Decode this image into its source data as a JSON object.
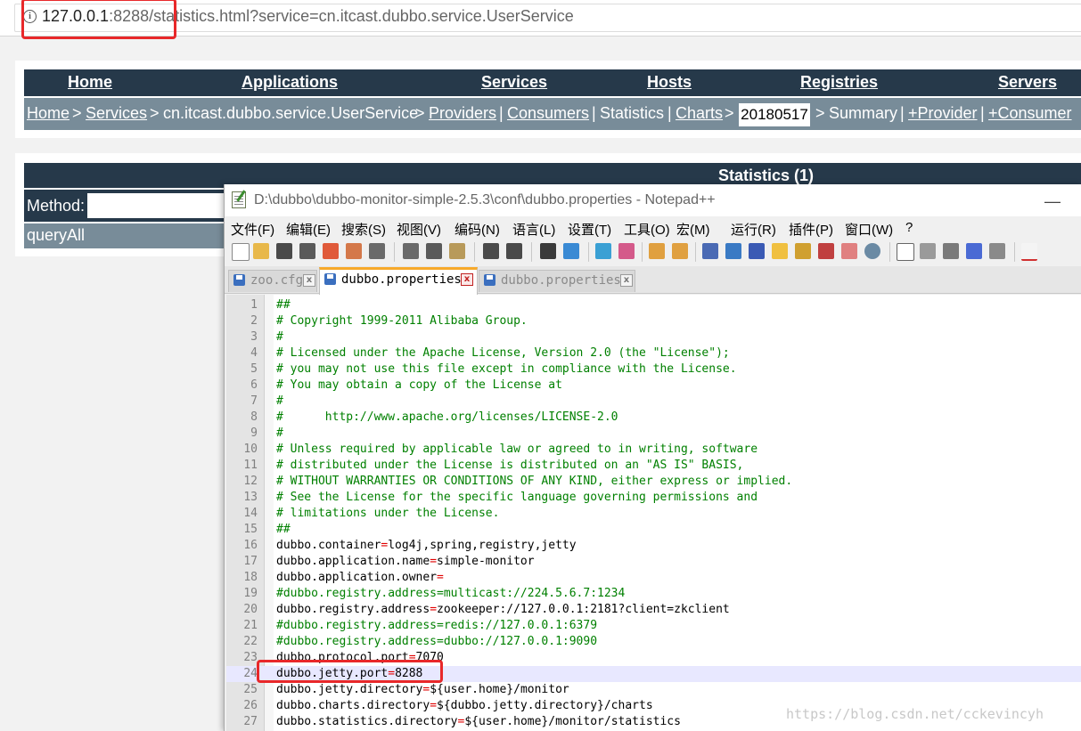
{
  "browser": {
    "url_host": "127.0.0.1",
    "url_rest": ":8288/statistics.html?service=cn.itcast.dubbo.service.UserService"
  },
  "nav": {
    "items": [
      "Home",
      "Applications",
      "Services",
      "Hosts",
      "Registries",
      "Servers"
    ]
  },
  "breadcrumb": {
    "home": "Home",
    "sep1": ">",
    "services": "Services",
    "sep2": ">",
    "service_name": "cn.itcast.dubbo.service.UserService",
    "sep3": ">",
    "providers": "Providers",
    "pipe1": "|",
    "consumers": "Consumers",
    "pipe2": "|",
    "statistics": "Statistics",
    "pipe3": "|",
    "charts": "Charts",
    "sep4": ">",
    "date": "20180517",
    "sep5": ">",
    "summary": "Summary",
    "pipe4": "|",
    "add_provider": "+Provider",
    "pipe5": "|",
    "add_consumer": "+Consumer"
  },
  "stats": {
    "title": "Statistics (1)",
    "method_label": "Method:",
    "method_value": "",
    "rows": [
      "queryAll"
    ]
  },
  "notepad": {
    "title": "D:\\dubbo\\dubbo-monitor-simple-2.5.3\\conf\\dubbo.properties - Notepad++",
    "minimize": "—",
    "menus": [
      "文件(F)",
      "编辑(E)",
      "搜索(S)",
      "视图(V)",
      "编码(N)",
      "语言(L)",
      "设置(T)",
      "工具(O)",
      "宏(M)",
      "运行(R)",
      "插件(P)",
      "窗口(W)",
      "?"
    ],
    "tabs": [
      {
        "name": "zoo.cfg",
        "active": false
      },
      {
        "name": "dubbo.properties",
        "active": true
      },
      {
        "name": "dubbo.properties",
        "active": false
      }
    ],
    "tab_close": "x",
    "lines": [
      {
        "n": "1",
        "t": "##"
      },
      {
        "n": "2",
        "t": "# Copyright 1999-2011 Alibaba Group."
      },
      {
        "n": "3",
        "t": "#"
      },
      {
        "n": "4",
        "t": "# Licensed under the Apache License, Version 2.0 (the \"License\");"
      },
      {
        "n": "5",
        "t": "# you may not use this file except in compliance with the License."
      },
      {
        "n": "6",
        "t": "# You may obtain a copy of the License at"
      },
      {
        "n": "7",
        "t": "#"
      },
      {
        "n": "8",
        "t": "#      http://www.apache.org/licenses/LICENSE-2.0"
      },
      {
        "n": "9",
        "t": "#"
      },
      {
        "n": "10",
        "t": "# Unless required by applicable law or agreed to in writing, software"
      },
      {
        "n": "11",
        "t": "# distributed under the License is distributed on an \"AS IS\" BASIS,"
      },
      {
        "n": "12",
        "t": "# WITHOUT WARRANTIES OR CONDITIONS OF ANY KIND, either express or implied."
      },
      {
        "n": "13",
        "t": "# See the License for the specific language governing permissions and"
      },
      {
        "n": "14",
        "t": "# limitations under the License."
      },
      {
        "n": "15",
        "t": "##"
      },
      {
        "n": "16",
        "t": "dubbo.container=log4j,spring,registry,jetty"
      },
      {
        "n": "17",
        "t": "dubbo.application.name=simple-monitor"
      },
      {
        "n": "18",
        "t": "dubbo.application.owner="
      },
      {
        "n": "19",
        "t": "#dubbo.registry.address=multicast://224.5.6.7:1234"
      },
      {
        "n": "20",
        "t": "dubbo.registry.address=zookeeper://127.0.0.1:2181?client=zkclient"
      },
      {
        "n": "21",
        "t": "#dubbo.registry.address=redis://127.0.0.1:6379"
      },
      {
        "n": "22",
        "t": "#dubbo.registry.address=dubbo://127.0.0.1:9090"
      },
      {
        "n": "23",
        "t": "dubbo.protocol.port=7070"
      },
      {
        "n": "24",
        "t": "dubbo.jetty.port=8288"
      },
      {
        "n": "25",
        "t": "dubbo.jetty.directory=${user.home}/monitor"
      },
      {
        "n": "26",
        "t": "dubbo.charts.directory=${dubbo.jetty.directory}/charts"
      },
      {
        "n": "27",
        "t": "dubbo.statistics.directory=${user.home}/monitor/statistics"
      }
    ],
    "current_line": "24"
  },
  "watermark": "https://blog.csdn.net/cckevincyh",
  "colors": {
    "nav_dark": "#26394a",
    "crumb_gray": "#788c99",
    "highlight_red": "#e8282a",
    "comment_green": "#008000",
    "tab_accent": "#f7a92a"
  }
}
